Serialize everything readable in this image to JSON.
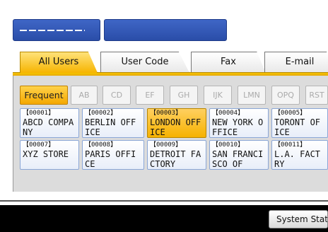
{
  "search_fields": {
    "left_placeholder": "—————",
    "right_value": ""
  },
  "tabs": [
    {
      "label": "All Users",
      "active": true
    },
    {
      "label": "User Code",
      "active": false
    },
    {
      "label": "Fax",
      "active": false
    },
    {
      "label": "E-mail",
      "active": false
    }
  ],
  "filters": [
    {
      "label": "Frequent",
      "active": true
    },
    {
      "label": "AB"
    },
    {
      "label": "CD"
    },
    {
      "label": "EF"
    },
    {
      "label": "GH"
    },
    {
      "label": "IJK"
    },
    {
      "label": "LMN"
    },
    {
      "label": "OPQ"
    },
    {
      "label": "RST"
    }
  ],
  "entries": [
    {
      "code": "【00001】",
      "name_line1": "ABCD COMPA",
      "name_line2": "NY"
    },
    {
      "code": "【00002】",
      "name_line1": "BERLIN OFF",
      "name_line2": "ICE"
    },
    {
      "code": "【00003】",
      "name_line1": "LONDON OFF",
      "name_line2": "ICE",
      "active": true
    },
    {
      "code": "【00004】",
      "name_line1": "NEW YORK O",
      "name_line2": "FFICE"
    },
    {
      "code": "【00005】",
      "name_line1": "TORONT OF",
      "name_line2": "ICE"
    },
    {
      "code": "【00007】",
      "name_line1": "XYZ STORE",
      "name_line2": ""
    },
    {
      "code": "【00008】",
      "name_line1": "PARIS OFFI",
      "name_line2": "CE"
    },
    {
      "code": "【00009】",
      "name_line1": "DETROIT FA",
      "name_line2": "CTORY"
    },
    {
      "code": "【00010】",
      "name_line1": "SAN FRANCI",
      "name_line2": "SCO OF"
    },
    {
      "code": "【00011】",
      "name_line1": "L.A. FACT",
      "name_line2": "RY"
    }
  ],
  "footer": {
    "system_status_label": "System Status"
  },
  "colors": {
    "accent_yellow": "#f6b400",
    "field_blue": "#2a4da8",
    "card_border": "#8aa6d6"
  }
}
